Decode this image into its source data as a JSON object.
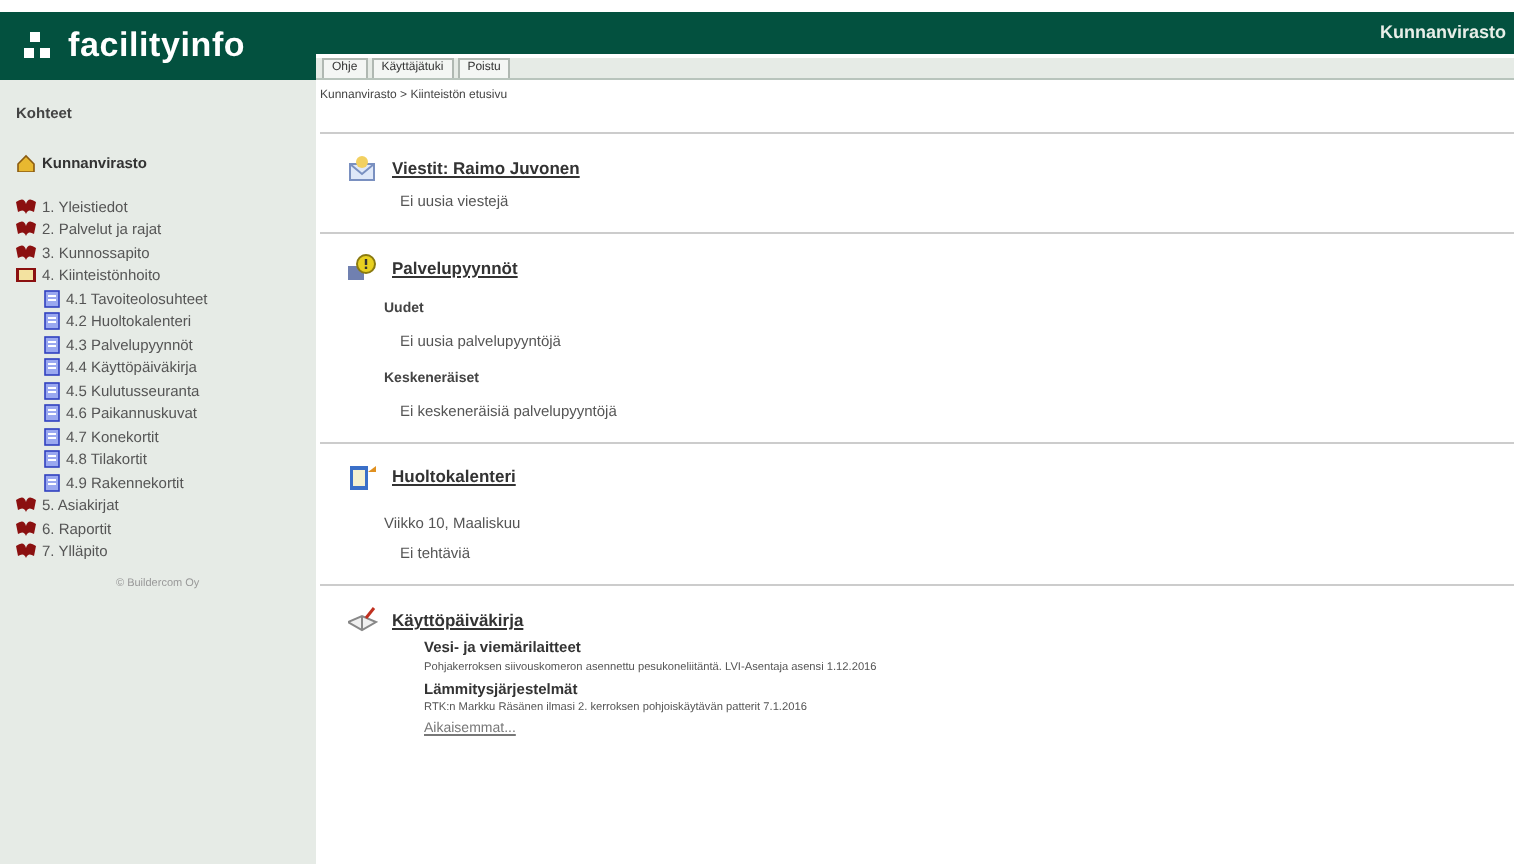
{
  "logo": "facilityinfo",
  "tabs": [
    {
      "label": "Ohje"
    },
    {
      "label": "Käyttäjätuki"
    },
    {
      "label": "Poistu"
    }
  ],
  "header_title": "Kunnanvirasto",
  "breadcrumb": "Kunnanvirasto > Kiinteistön etusivu",
  "sidebar": {
    "title": "Kohteet",
    "root": "Kunnanvirasto",
    "items": [
      {
        "label": "1. Yleistiedot",
        "expanded": false
      },
      {
        "label": "2. Palvelut ja rajat",
        "expanded": false
      },
      {
        "label": "3. Kunnossapito",
        "expanded": false
      },
      {
        "label": "4. Kiinteistönhoito",
        "expanded": true,
        "children": [
          {
            "label": "4.1 Tavoiteolosuhteet"
          },
          {
            "label": "4.2 Huoltokalenteri"
          },
          {
            "label": "4.3 Palvelupyynnöt"
          },
          {
            "label": "4.4 Käyttöpäiväkirja"
          },
          {
            "label": "4.5 Kulutusseuranta"
          },
          {
            "label": "4.6 Paikannuskuvat"
          },
          {
            "label": "4.7 Konekortit"
          },
          {
            "label": "4.8 Tilakortit"
          },
          {
            "label": "4.9 Rakennekortit"
          }
        ]
      },
      {
        "label": "5. Asiakirjat",
        "expanded": false
      },
      {
        "label": "6. Raportit",
        "expanded": false
      },
      {
        "label": "7. Ylläpito",
        "expanded": false
      }
    ],
    "footer": "© Buildercom Oy"
  },
  "sections": [
    {
      "kind": "messages",
      "title": "Viestit: Raimo Juvonen",
      "blocks": [
        {
          "kind": "text",
          "text": "Ei uusia viestejä"
        }
      ]
    },
    {
      "kind": "requests",
      "title": "Palvelupyynnöt",
      "blocks": [
        {
          "kind": "label",
          "text": "Uudet"
        },
        {
          "kind": "text",
          "text": "Ei uusia palvelupyyntöjä"
        },
        {
          "kind": "label",
          "text": "Keskeneräiset"
        },
        {
          "kind": "text",
          "text": "Ei keskeneräisiä palvelupyyntöjä"
        }
      ]
    },
    {
      "kind": "calendar",
      "title": "Huoltokalenteri",
      "blocks": [
        {
          "kind": "subtitle",
          "text": "Viikko 10, Maaliskuu"
        },
        {
          "kind": "text",
          "text": "Ei tehtäviä"
        }
      ]
    },
    {
      "kind": "logbook",
      "title": "Käyttöpäiväkirja",
      "blocks": [
        {
          "kind": "heading",
          "text": "Vesi- ja viemärilaitteet"
        },
        {
          "kind": "note",
          "text": "Pohjakerroksen siivouskomeron asennettu pesukoneliitäntä. LVI-Asentaja asensi 1.12.2016"
        },
        {
          "kind": "heading",
          "text": "Lämmitysjärjestelmät"
        },
        {
          "kind": "note",
          "text": "RTK:n Markku Räsänen ilmasi 2. kerroksen pohjoiskäytävän patterit 7.1.2016"
        },
        {
          "kind": "link",
          "text": "Aikaisemmat..."
        }
      ]
    }
  ]
}
